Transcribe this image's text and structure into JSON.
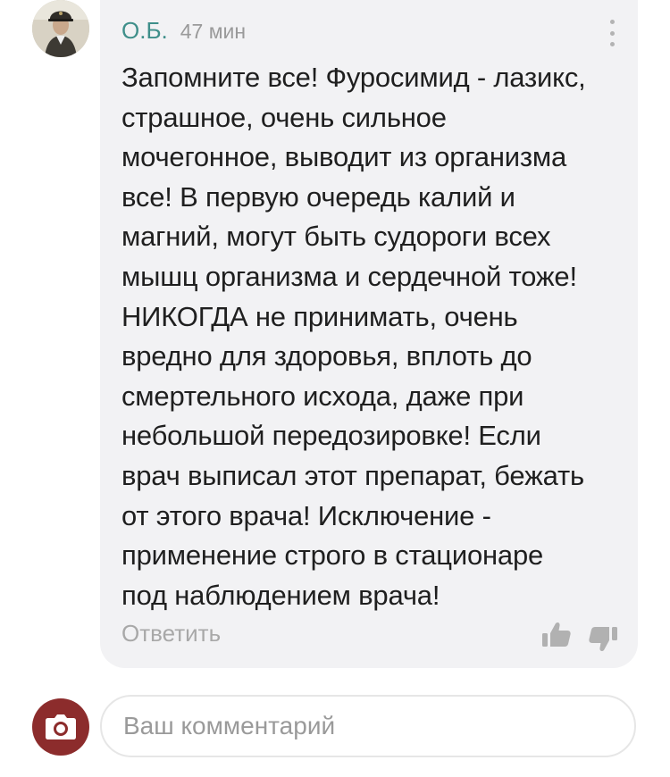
{
  "comment": {
    "author": "О.Б.",
    "time": "47 мин",
    "lines": [
      "Запомните все! Фуросимид - лазикс,",
      "страшное, очень сильное",
      "мочегонное, выводит из организма",
      "все! В первую очередь калий и",
      "магний, могут быть судороги всех",
      "мышц организма и сердечной тоже!",
      "НИКОГДА не принимать, очень",
      "вредно для здоровья, вплоть до",
      "смертельного исхода, даже при",
      "небольшой передозировке! Если",
      "врач выписал этот препарат, бежать",
      "от этого врача! Исключение -",
      "применение строго в стационаре",
      "под наблюдением врача!"
    ],
    "reply_label": "Ответить",
    "like_icon": "thumbs-up-icon",
    "dislike_icon": "thumbs-down-icon",
    "more_icon": "more-vertical-icon"
  },
  "composer": {
    "placeholder": "Ваш комментарий",
    "value": "",
    "avatar_icon": "camera-icon"
  },
  "colors": {
    "author": "#3f8f8a",
    "bubble": "#f2f2f4",
    "user_avatar": "#8c2c2c"
  }
}
